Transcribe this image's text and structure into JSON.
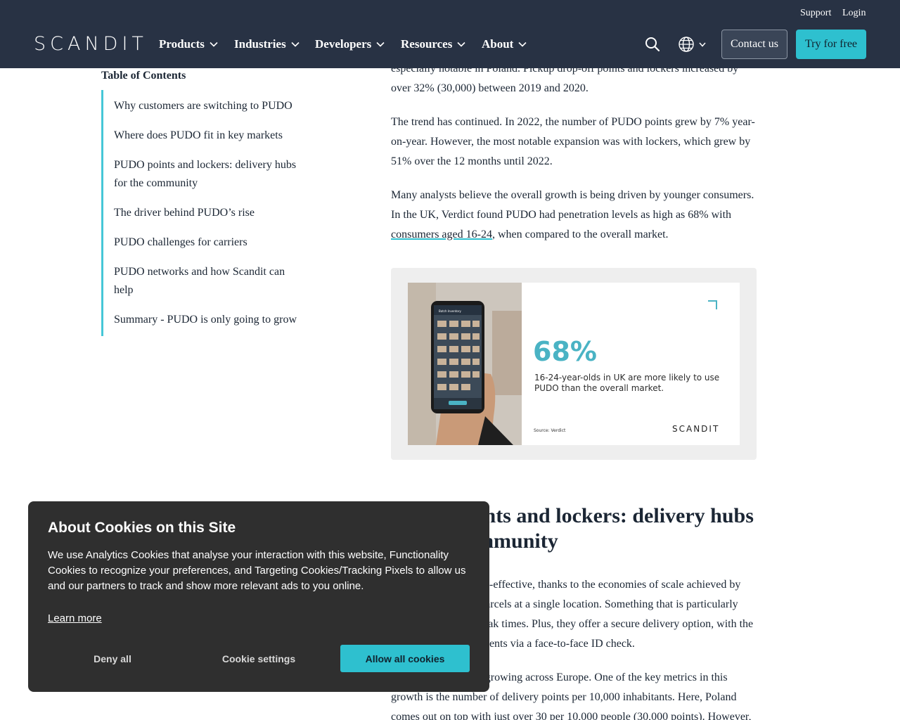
{
  "header": {
    "utility_links": [
      "Support",
      "Login"
    ],
    "logo_text": "SCANDIT",
    "nav": [
      "Products",
      "Industries",
      "Developers",
      "Resources",
      "About"
    ],
    "contact_label": "Contact us",
    "try_label": "Try for free",
    "icons": [
      "search-icon",
      "globe-icon",
      "chevron-down-icon"
    ],
    "colors": {
      "header_bg": "#283244",
      "accent": "#2ec0cf"
    }
  },
  "toc": {
    "title": "Table of Contents",
    "items": [
      "Why customers are switching to PUDO",
      "Where does PUDO fit in key markets",
      "PUDO points and lockers: delivery hubs for the community",
      "The driver behind PUDO’s rise",
      "PUDO challenges for carriers",
      "PUDO networks and how Scandit can help",
      "Summary - PUDO is only going to grow"
    ]
  },
  "article": {
    "p1": "especially notable in Poland. Pickup drop-off points and lockers increased by over 32% (30,000) between 2019 and 2020.",
    "p2": "The trend has continued. In 2022, the number of PUDO points grew by 7% year-on-year. However, the most notable expansion was with lockers, which grew by 51% over the 12 months until 2022.",
    "p3_before": "Many analysts believe the overall growth is being driven by younger consumers. In the UK, Verdict found PUDO had penetration levels as high as 68% with ",
    "p3_link": "consumers aged 16-24",
    "p3_after": ", when compared to the overall market.",
    "figure": {
      "stat": "68%",
      "description": "16-24-year-olds in UK are more likely to use PUDO than the overall market.",
      "source": "Source: Verdict",
      "logo": "SCANDIT",
      "phone_screen_title": "Batch Inventory"
    },
    "h2": "PUDO points and lockers: delivery hubs for the community",
    "p4": "PUDO points are cost-effective, thanks to the economies of scale achieved by delivering multiple parcels at a single location. Something that is particularly useful during busy peak times. Plus, they offer a secure delivery option, with the ability to verify recipients via a face-to-face ID check.",
    "p5": "PUDO networks are growing across Europe. One of the key metrics in this growth is the number of delivery points per 10,000 inhabitants. Here, Poland comes out on top with just over 30 per 10,000 people (30,000 points). However, when it comes"
  },
  "cookie": {
    "title": "About Cookies on this Site",
    "body": "We use Analytics Cookies that analyse your interaction with this website, Functionality Cookies to recognize your preferences, and Targeting Cookies/Tracking Pixels to allow us and our partners to track and show more relevant ads to you online.",
    "learn_more": "Learn more",
    "deny": "Deny all",
    "settings": "Cookie settings",
    "allow": "Allow all cookies"
  }
}
